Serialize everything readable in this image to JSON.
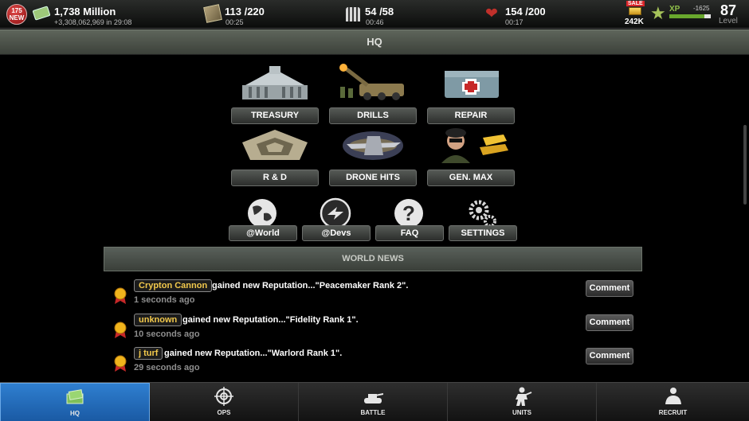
{
  "topbar": {
    "badge_count": "175",
    "badge_label": "NEW",
    "money": "1,738 Million",
    "money_income": "+3,308,062,969 in 29:08",
    "supply": "113 /220",
    "supply_timer": "00:25",
    "ammo": "54 /58",
    "ammo_timer": "00:46",
    "health": "154 /200",
    "health_timer": "00:17",
    "sale_label": "SALE",
    "gold": "242K",
    "xp_label": "XP",
    "xp_to_next": "-1625",
    "xp_progress": 0.85,
    "level": "87",
    "level_label": "Level"
  },
  "header": {
    "title": "HQ"
  },
  "tiles": [
    {
      "label": "TREASURY",
      "icon": "treasury-building-icon"
    },
    {
      "label": "DRILLS",
      "icon": "artillery-drill-icon"
    },
    {
      "label": "REPAIR",
      "icon": "medical-crate-icon"
    },
    {
      "label": "R & D",
      "icon": "pentagon-building-icon"
    },
    {
      "label": "DRONE HITS",
      "icon": "drone-icon"
    },
    {
      "label": "GEN. MAX",
      "icon": "general-with-gold-icon"
    }
  ],
  "links": [
    {
      "label": "@World",
      "icon": "globe-icon"
    },
    {
      "label": "@Devs",
      "icon": "devs-logo-icon"
    },
    {
      "label": "FAQ",
      "icon": "question-icon"
    },
    {
      "label": "SETTINGS",
      "icon": "gears-icon"
    }
  ],
  "news": {
    "title": "WORLD NEWS",
    "items": [
      {
        "name": "Crypton Cannon",
        "message": "gained new Reputation...\"Peacemaker Rank 2\".",
        "time": "1 seconds ago",
        "action": "Comment"
      },
      {
        "name": "unknown",
        "message": "gained new Reputation...\"Fidelity Rank 1\".",
        "time": "10 seconds ago",
        "action": "Comment"
      },
      {
        "name": "j turf",
        "message": "gained new Reputation...\"Warlord Rank 1\".",
        "time": "29 seconds ago",
        "action": "Comment"
      }
    ]
  },
  "nav": [
    {
      "label": "HQ",
      "icon": "hq-money-icon",
      "active": true
    },
    {
      "label": "OPS",
      "icon": "crosshair-icon",
      "active": false
    },
    {
      "label": "BATTLE",
      "icon": "tank-icon",
      "active": false
    },
    {
      "label": "UNITS",
      "icon": "soldier-icon",
      "active": false
    },
    {
      "label": "RECRUIT",
      "icon": "recruit-icon",
      "active": false
    }
  ],
  "colors": {
    "accent_blue": "#2f7fd0",
    "name_gold": "#f2c94c",
    "xp_green": "#69a82d"
  }
}
